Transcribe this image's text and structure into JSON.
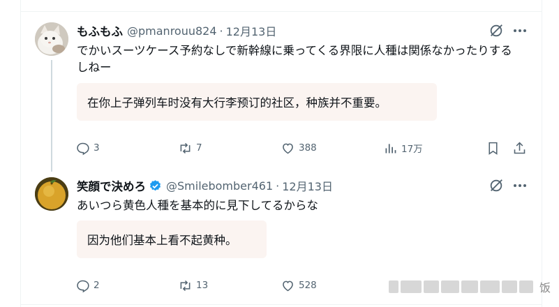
{
  "tweets": [
    {
      "name": "もふもふ",
      "handle": "@pmanrouu824",
      "separator": "·",
      "date": "12月13日",
      "verified": false,
      "text": "でかいスーツケース予約なしで新幹線に乗ってくる界限に人種は関係なかったりするしねー",
      "translation": "在你上子弹列车时没有大行李预订的社区，种族并不重要。",
      "replies": "3",
      "retweets": "7",
      "likes": "388",
      "views": "17万"
    },
    {
      "name": "笑顔で決めろ",
      "handle": "@Smilebomber461",
      "separator": "·",
      "date": "12月13日",
      "verified": true,
      "text": "あいつら黄色人種を基本的に見下してるからな",
      "translation": "因为他们基本上看不起黄种。",
      "replies": "2",
      "retweets": "13",
      "likes": "528"
    }
  ],
  "icons": {
    "grok": "grok-icon",
    "more": "more-icon",
    "reply": "reply-icon",
    "retweet": "retweet-icon",
    "like": "like-icon",
    "views": "views-icon",
    "bookmark": "bookmark-icon",
    "share": "share-icon",
    "verified": "verified-badge-icon"
  },
  "colors": {
    "text": "#0f1419",
    "secondary": "#536471",
    "verified": "#1d9bf0",
    "translation_bg": "#fbf4f1",
    "thread_line": "#cfd9de"
  },
  "watermark": {
    "text": "饭"
  }
}
